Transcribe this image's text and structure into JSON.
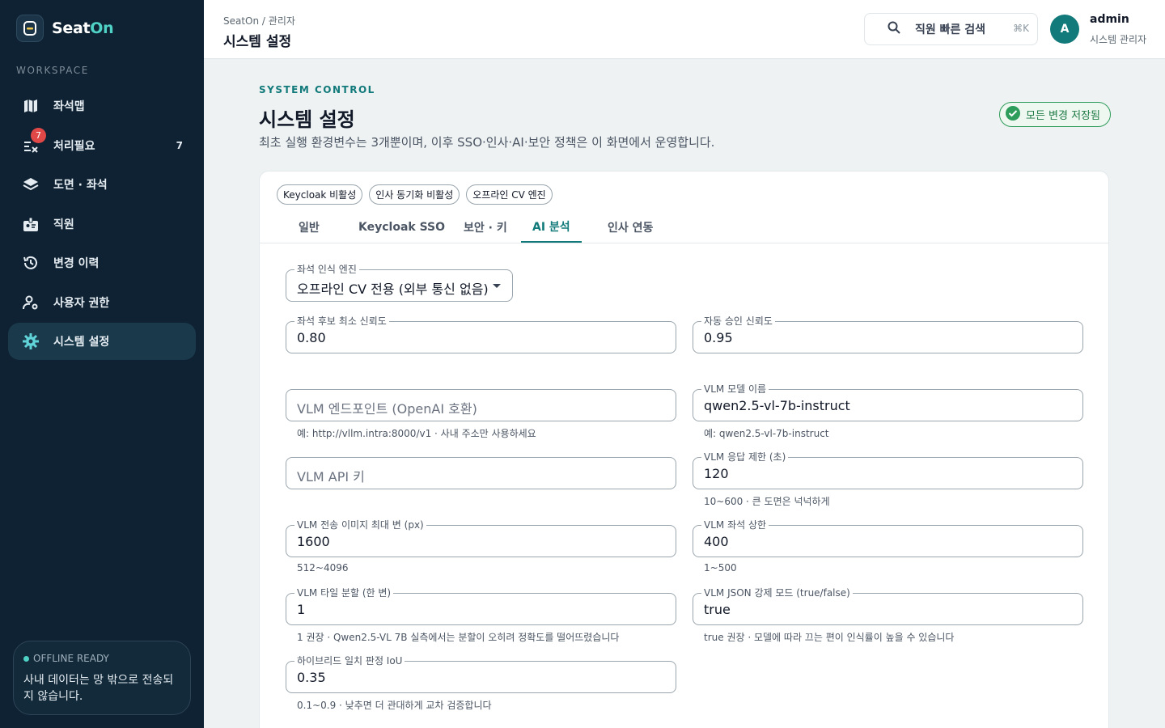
{
  "brand": {
    "name_prefix": "Seat",
    "name_accent": "On"
  },
  "sidebar": {
    "section_label": "WORKSPACE",
    "items": [
      {
        "label": "좌석맵",
        "icon": "map-icon"
      },
      {
        "label": "처리필요",
        "icon": "review-icon",
        "badge": "7",
        "count": "7"
      },
      {
        "label": "도면 · 좌석",
        "icon": "layers-icon"
      },
      {
        "label": "직원",
        "icon": "badge-icon"
      },
      {
        "label": "변경 이력",
        "icon": "history-icon"
      },
      {
        "label": "사용자 권한",
        "icon": "user-gear-icon"
      },
      {
        "label": "시스템 설정",
        "icon": "gear-icon",
        "active": true
      }
    ],
    "offline": {
      "title": "OFFLINE READY",
      "text": "사내 데이터는 망 밖으로 전송되지 않습니다."
    }
  },
  "header": {
    "breadcrumb": "SeatOn / 관리자",
    "title": "시스템 설정",
    "search_label": "직원 빠른 검색",
    "shortcut": "⌘K",
    "user": {
      "initial": "A",
      "name": "admin",
      "role": "시스템 관리자"
    }
  },
  "page": {
    "eyebrow": "SYSTEM CONTROL",
    "title": "시스템 설정",
    "description": "최초 실행 환경변수는 3개뿐이며, 이후 SSO·인사·AI·보안 정책은 이 화면에서 운영합니다.",
    "saved_status": "모든 변경 저장됨"
  },
  "status_chips": [
    "Keycloak 비활성",
    "인사 동기화 비활성",
    "오프라인 CV 엔진"
  ],
  "tabs": [
    "일반",
    "Keycloak SSO",
    "보안 · 키",
    "AI 분석",
    "인사 연동"
  ],
  "active_tab": "AI 분석",
  "form": {
    "engine": {
      "label": "좌석 인식 엔진",
      "value": "오프라인 CV 전용 (외부 통신 없음)"
    },
    "min_confidence": {
      "label": "좌석 후보 최소 신뢰도",
      "value": "0.80"
    },
    "auto_approve": {
      "label": "자동 승인 신뢰도",
      "value": "0.95"
    },
    "vlm_endpoint": {
      "placeholder": "VLM 엔드포인트 (OpenAI 호환)",
      "helper": "예: http://vllm.intra:8000/v1 · 사내 주소만 사용하세요"
    },
    "vlm_model": {
      "label": "VLM 모델 이름",
      "value": "qwen2.5-vl-7b-instruct",
      "helper": "예: qwen2.5-vl-7b-instruct"
    },
    "vlm_api_key": {
      "placeholder": "VLM API 키"
    },
    "vlm_timeout": {
      "label": "VLM 응답 제한 (초)",
      "value": "120",
      "helper": "10~600 · 큰 도면은 넉넉하게"
    },
    "vlm_max_edge": {
      "label": "VLM 전송 이미지 최대 변 (px)",
      "value": "1600",
      "helper": "512~4096"
    },
    "vlm_seat_limit": {
      "label": "VLM 좌석 상한",
      "value": "400",
      "helper": "1~500"
    },
    "vlm_tiles": {
      "label": "VLM 타일 분할 (한 변)",
      "value": "1",
      "helper": "1 권장 · Qwen2.5-VL 7B 실측에서는 분할이 오히려 정확도를 떨어뜨렸습니다"
    },
    "vlm_json_mode": {
      "label": "VLM JSON 강제 모드 (true/false)",
      "value": "true",
      "helper": "true 권장 · 모델에 따라 끄는 편이 인식률이 높을 수 있습니다"
    },
    "hybrid_iou": {
      "label": "하이브리드 일치 판정 IoU",
      "value": "0.35",
      "helper": "0.1~0.9 · 낮추면 더 관대하게 교차 검증합니다"
    }
  },
  "colors": {
    "sidebar_bg": "#0f2233",
    "accent": "#127a7a",
    "brand_accent": "#4fd1c5",
    "badge_red": "#e04848",
    "saved_green": "#2e9c5a"
  }
}
